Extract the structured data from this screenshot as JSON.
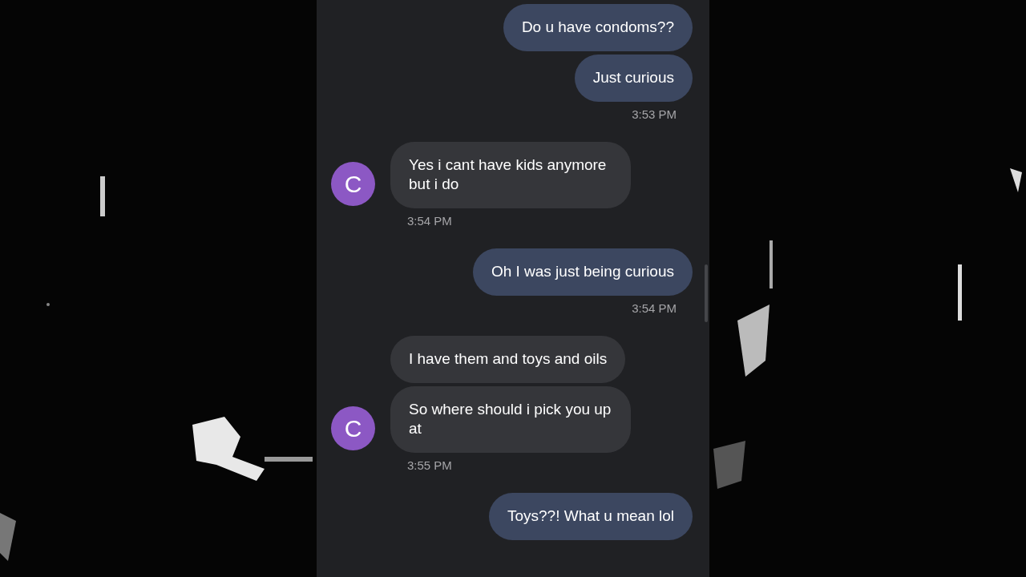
{
  "messages": [
    {
      "kind": "outgoing",
      "bubbles": [
        "Do u have condoms??",
        "Just curious"
      ],
      "time": "3:53 PM"
    },
    {
      "kind": "incoming",
      "avatar": "C",
      "bubbles": [
        "Yes i cant have kids anymore but i do"
      ],
      "time": "3:54 PM"
    },
    {
      "kind": "outgoing",
      "bubbles": [
        "Oh I was just being curious"
      ],
      "time": "3:54 PM"
    },
    {
      "kind": "incoming",
      "avatar": "C",
      "bubbles": [
        "I have them and toys and oils",
        "So where should i pick you up at"
      ],
      "time": "3:55 PM"
    },
    {
      "kind": "outgoing",
      "bubbles": [
        "Toys??! What u mean lol"
      ]
    }
  ]
}
